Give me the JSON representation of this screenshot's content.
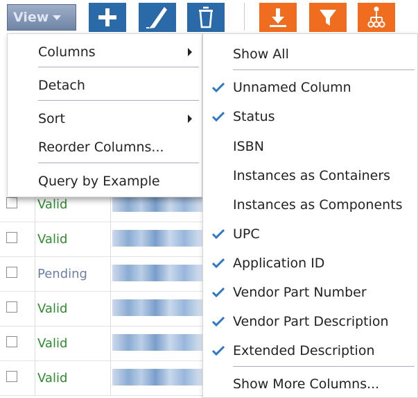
{
  "toolbar": {
    "view_label": "View",
    "icons": [
      "add-icon",
      "edit-icon",
      "delete-icon",
      "export-icon",
      "filter-icon",
      "hierarchy-icon"
    ],
    "colors": {
      "blue": "#2a6aa8",
      "orange": "#f06d1f"
    }
  },
  "main_menu": {
    "items": [
      {
        "label": "Columns",
        "submenu": true
      },
      {
        "label": "Detach"
      },
      {
        "label": "Sort",
        "submenu": true
      },
      {
        "label": "Reorder Columns..."
      },
      {
        "label": "Query by Example"
      }
    ]
  },
  "columns_menu": {
    "items": [
      {
        "label": "Show All",
        "checked": false
      },
      {
        "label": "Unnamed Column",
        "checked": true
      },
      {
        "label": "Status",
        "checked": true
      },
      {
        "label": "ISBN",
        "checked": false
      },
      {
        "label": "Instances as Containers",
        "checked": false
      },
      {
        "label": "Instances as Components",
        "checked": false
      },
      {
        "label": "UPC",
        "checked": true
      },
      {
        "label": "Application ID",
        "checked": true
      },
      {
        "label": "Vendor Part Number",
        "checked": true
      },
      {
        "label": "Vendor Part Description",
        "checked": true
      },
      {
        "label": "Extended Description",
        "checked": true
      },
      {
        "label": "Show More Columns..."
      }
    ]
  },
  "table": {
    "rows": [
      {
        "status": "Valid"
      },
      {
        "status": "Valid"
      },
      {
        "status": "Pending"
      },
      {
        "status": "Valid"
      },
      {
        "status": "Valid"
      },
      {
        "status": "Valid"
      }
    ]
  }
}
